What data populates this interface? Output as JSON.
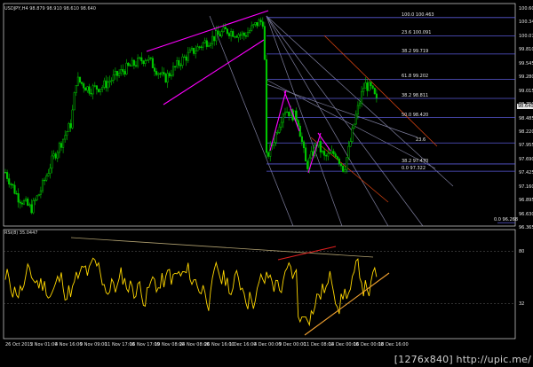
{
  "main_chart": {
    "title": "USDJPY,H4  98.879 98.910 98.610 98.640",
    "fib_levels": [
      {
        "label": "100.0 100.463",
        "value": 100.463
      },
      {
        "label": "23.6 100.091",
        "value": 100.091
      },
      {
        "label": "38.2 99.719",
        "value": 99.719
      },
      {
        "label": "61.8 99.202",
        "value": 99.202
      },
      {
        "label": "38.2 98.811",
        "value": 98.811
      },
      {
        "label": "50.0 98.420",
        "value": 98.42
      },
      {
        "label": "23.6",
        "value": 97.9
      },
      {
        "label": "38.2 97.470",
        "value": 97.47
      },
      {
        "label": "0.0 97.322",
        "value": 97.322
      },
      {
        "label": "0.0 96.268",
        "value": 96.268
      }
    ],
    "price_axis": [
      "100.605",
      "100.340",
      "100.075",
      "99.810",
      "99.545",
      "99.280",
      "99.015",
      "98.750",
      "98.485",
      "98.220",
      "97.955",
      "97.690",
      "97.425",
      "97.160",
      "96.895",
      "96.630",
      "96.365"
    ],
    "current_price": "98.640",
    "ylim": [
      96.2,
      100.75
    ],
    "colors": {
      "candles": "#00c800",
      "fib": "#5a5ad8",
      "fan": "#8080a0",
      "channel": "#ff00ff",
      "red_channel": "#d04010"
    }
  },
  "indicator": {
    "title": "RSI(8) 35.0447",
    "levels": [
      "80",
      "32"
    ],
    "ylim": [
      0,
      100
    ],
    "color": "#ffd700"
  },
  "time_axis": [
    "26 Oct 2015",
    "2 Nov 01:00",
    "4 Nov 16:00",
    "9 Nov 09:00",
    "11 Nov 17:00",
    "16 Nov 17:00",
    "19 Nov 08:00",
    "24 Nov 08:00",
    "26 Nov 16:00",
    "1 Dec 16:00",
    "4 Dec 00:00",
    "9 Dec 00:00",
    "11 Dec 08:00",
    "14 Dec 00:00",
    "16 Dec 00:00",
    "18 Dec 16:00"
  ],
  "watermark": "[1276x840] http://upic.me/"
}
